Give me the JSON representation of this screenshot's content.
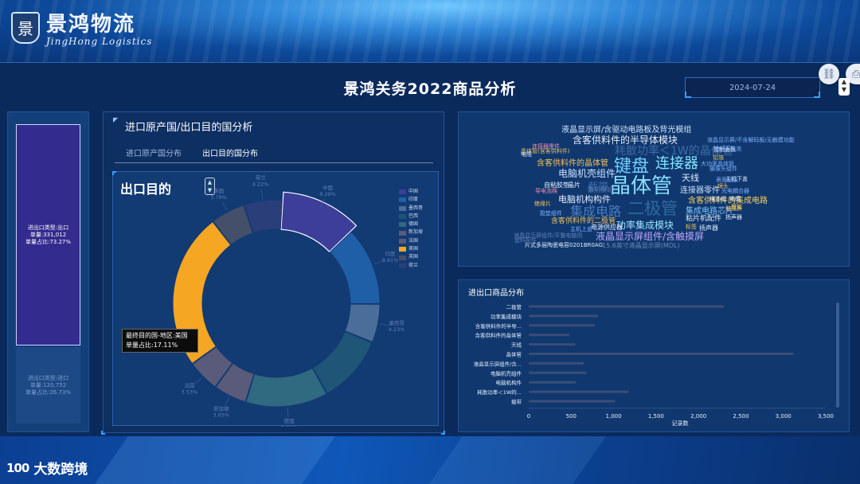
{
  "brand": {
    "badge_top": "Jing",
    "badge_char": "景",
    "name_cn": "景鸿物流",
    "name_en": "JingHong Logistics"
  },
  "dashboard": {
    "title": "景鸿关务2022商品分析",
    "date_value": "2024-07-24"
  },
  "left_panel": {
    "top_label": "进出口类型:出口",
    "top_count": "单量:331,012",
    "top_ratio": "单量占比:73.27%",
    "top_fraction": 0.7327,
    "bottom_label": "进出口类型:进口",
    "bottom_count": "单量:120,752",
    "bottom_ratio": "单量占比:26.73%"
  },
  "origin_panel": {
    "title": "进口原产国/出口目的国分析",
    "tabs": [
      "进口原产国分布",
      "出口目的国分布"
    ],
    "active_tab": 1,
    "chart_title": "出口目的",
    "tooltip_line1": "最终目的国-地区:美国",
    "tooltip_line2": "单量占比:17.11%"
  },
  "colors": {
    "accent": "#3aa0ff",
    "panel": "#10386e",
    "bar": "#3b4d75"
  },
  "chart_data": [
    {
      "type": "pie",
      "title": "出口目的",
      "legend_position": "right",
      "categories": [
        "中国",
        "印度",
        "墨西哥",
        "巴西",
        "德国",
        "新加坡",
        "法国",
        "美国",
        "英国",
        "荷兰"
      ],
      "colors": [
        "#3d3d9a",
        "#1f5fa8",
        "#4a6d9a",
        "#1f5577",
        "#2f6a80",
        "#5a5a7a",
        "#5a5a7a",
        "#f5a623",
        "#44506a",
        "#2a3e7a"
      ],
      "values": [
        8.29,
        8.61,
        4.23,
        7.5,
        9.05,
        3.65,
        3.53,
        17.11,
        3.79,
        4.22
      ],
      "labels": [
        "8.29%",
        "8.61%",
        "4.23%",
        "",
        "9.05%",
        "3.65%",
        "3.53%",
        "",
        "3.79%",
        "4.22%"
      ],
      "highlight": "中国"
    },
    {
      "type": "bar",
      "orientation": "horizontal",
      "title": "进出口商品分布",
      "xlabel": "记录数",
      "categories": [
        "二极管",
        "功率集成模块",
        "含客供料件的半导...",
        "含客供料件的晶体管",
        "天线",
        "晶体管",
        "液晶显示屏组件/含...",
        "电脑机壳组件",
        "电脑机构件",
        "耗散功率＜1W的...",
        "载带"
      ],
      "values": [
        2300,
        820,
        780,
        480,
        550,
        3120,
        650,
        680,
        560,
        1180,
        1020
      ],
      "xlim": [
        0,
        3500
      ],
      "xticks": [
        "0",
        "500",
        "1,000",
        "1,500",
        "2,000",
        "2,500",
        "3,000",
        "3,500"
      ]
    }
  ],
  "word_cloud": {
    "words": [
      {
        "text": "液晶显示屏/含驱动电路板及背光模组",
        "color": "#cfe3ff",
        "size": 10
      },
      {
        "text": "含客供料件的半导体模块",
        "color": "#e7f0ff",
        "size": 12
      },
      {
        "text": "耗散功率＜1W的晶体管",
        "color": "#3d6aa6",
        "size": 14
      },
      {
        "text": "含客供料件的晶体管",
        "color": "#f3c15a",
        "size": 10
      },
      {
        "text": "电脑机壳组件",
        "color": "#cfe0ff",
        "size": 12
      },
      {
        "text": "键盘",
        "color": "#72d0ff",
        "size": 22
      },
      {
        "text": "连接器",
        "color": "#7fe6ff",
        "size": 18
      },
      {
        "text": "晶体管",
        "color": "#86e0ff",
        "size": 26
      },
      {
        "text": "连接器零件",
        "color": "#cfe0ff",
        "size": 10
      },
      {
        "text": "天线",
        "color": "#e0ecff",
        "size": 11
      },
      {
        "text": "载带",
        "color": "#3e6fae",
        "size": 13
      },
      {
        "text": "电脑机构构件",
        "color": "#e6efff",
        "size": 11
      },
      {
        "text": "集成电路",
        "color": "#4a7cbe",
        "size": 16
      },
      {
        "text": "二极管",
        "color": "#2d6aa0",
        "size": 21
      },
      {
        "text": "含客供料件的集成电路",
        "color": "#f6cf64",
        "size": 10
      },
      {
        "text": "集成电路芯片",
        "color": "#7fc6ff",
        "size": 10
      },
      {
        "text": "功率集成模块",
        "color": "#9ae3ff",
        "size": 12
      },
      {
        "text": "液晶显示屏组件/含触摸屏",
        "color": "#bfa6ff",
        "size": 12
      },
      {
        "text": "粘片机配件",
        "color": "#e6efff",
        "size": 9
      },
      {
        "text": "扬声器",
        "color": "#e6efff",
        "size": 8
      },
      {
        "text": "含客供料件的二极管",
        "color": "#f3c15a",
        "size": 9
      },
      {
        "text": "主机上盖",
        "color": "#7fb0ff",
        "size": 7
      },
      {
        "text": "电源供应器",
        "color": "#e6efff",
        "size": 8
      },
      {
        "text": "自粘胶垫",
        "color": "#e6efff",
        "size": 8
      },
      {
        "text": "晶片",
        "color": "#e6efff",
        "size": 8
      },
      {
        "text": "液晶显示屏组件/平整电脑用",
        "color": "#5f7fb5",
        "size": 7
      },
      {
        "text": "15.6英寸液晶显示屏(MDL)",
        "color": "#6f88b5",
        "size": 8
      },
      {
        "text": "片式多层陶瓷电容0201BR0AG",
        "color": "#e6efff",
        "size": 7
      },
      {
        "text": "晶体管(含客供料件)",
        "color": "#f3c15a",
        "size": 7
      },
      {
        "text": "连接器零件",
        "color": "#f08aa8",
        "size": 7
      },
      {
        "text": "电阻",
        "color": "#e6efff",
        "size": 7
      },
      {
        "text": "导电泡棉",
        "color": "#f08aa8",
        "size": 7
      },
      {
        "text": "散热模组",
        "color": "#5f7fb5",
        "size": 8
      },
      {
        "text": "绝缘片",
        "color": "#f3c15a",
        "size": 7
      },
      {
        "text": "胶垫组件",
        "color": "#7fb0ff",
        "size": 7
      },
      {
        "text": "触摸屏",
        "color": "#f3c15a",
        "size": 7
      },
      {
        "text": "标签",
        "color": "#f3c15a",
        "size": 7
      },
      {
        "text": "镜头",
        "color": "#f3c15a",
        "size": 7
      },
      {
        "text": "液晶显示屏/不含解码板/无触摸功能",
        "color": "#7fb0ff",
        "size": 7
      },
      {
        "text": "控制面板",
        "color": "#e6efff",
        "size": 7
      },
      {
        "text": "铝箔",
        "color": "#f3c15a",
        "size": 7
      },
      {
        "text": "笔记本电池",
        "color": "#7fb0ff",
        "size": 7
      },
      {
        "text": "摄像头组件",
        "color": "#7fb0ff",
        "size": 7
      },
      {
        "text": "主机下盖",
        "color": "#e6efff",
        "size": 7
      },
      {
        "text": "大功率晶体管",
        "color": "#7fb0ff",
        "size": 7
      },
      {
        "text": "扬声器",
        "color": "#e6efff",
        "size": 7
      },
      {
        "text": "光电耦合器",
        "color": "#7fb0ff",
        "size": 7
      },
      {
        "text": "框架",
        "color": "#f3c15a",
        "size": 7
      },
      {
        "text": "电感",
        "color": "#e6efff",
        "size": 7
      },
      {
        "text": "表面贴装",
        "color": "#7fb0ff",
        "size": 7
      },
      {
        "text": "塑料配件",
        "color": "#5f7fb5",
        "size": 7
      },
      {
        "text": "电池组",
        "color": "#e6efff",
        "size": 7
      }
    ]
  },
  "footer": {
    "mark": "100",
    "name": "大数跨境"
  }
}
